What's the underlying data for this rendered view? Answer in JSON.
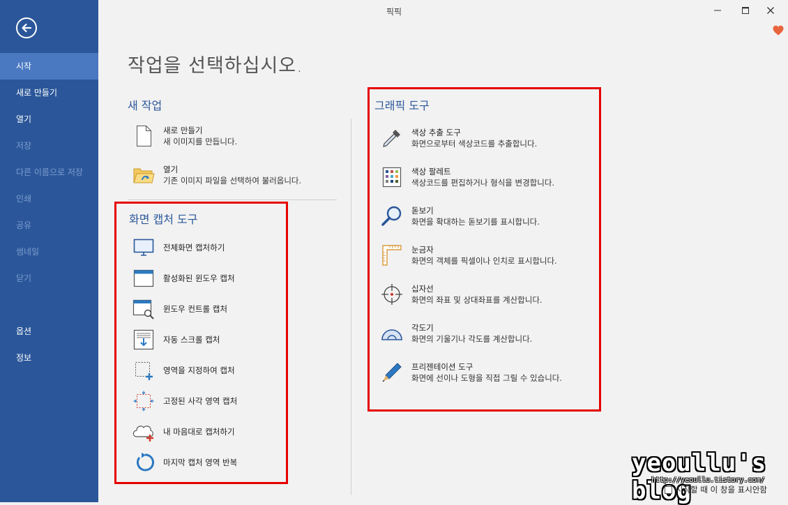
{
  "app": {
    "title": "픽픽"
  },
  "sidebar": {
    "items": [
      {
        "label": "시작",
        "state": "active"
      },
      {
        "label": "새로 만들기",
        "state": "normal"
      },
      {
        "label": "열기",
        "state": "normal"
      },
      {
        "label": "저장",
        "state": "disabled"
      },
      {
        "label": "다른 이름으로 저장",
        "state": "disabled"
      },
      {
        "label": "인쇄",
        "state": "disabled"
      },
      {
        "label": "공유",
        "state": "disabled"
      },
      {
        "label": "썸네일",
        "state": "disabled"
      },
      {
        "label": "닫기",
        "state": "disabled"
      },
      {
        "label": "옵션",
        "state": "normal"
      },
      {
        "label": "정보",
        "state": "normal"
      }
    ]
  },
  "main": {
    "title": "작업을 선택하십시오.",
    "new_task": {
      "title": "새 작업",
      "items": [
        {
          "title": "새로 만들기",
          "desc": "새 이미지를 만듭니다.",
          "icon": "new-file-icon"
        },
        {
          "title": "열기",
          "desc": "기존 이미지 파일을 선택하여 불러옵니다.",
          "icon": "open-folder-icon"
        }
      ]
    },
    "capture": {
      "title": "화면 캡처 도구",
      "items": [
        {
          "label": "전체화면 캡처하기",
          "icon": "monitor-icon"
        },
        {
          "label": "활성화된 윈도우 캡처",
          "icon": "window-icon"
        },
        {
          "label": "윈도우 컨트롤 캡처",
          "icon": "window-control-icon"
        },
        {
          "label": "자동 스크롤 캡처",
          "icon": "scroll-capture-icon"
        },
        {
          "label": "영역을 지정하여 캡처",
          "icon": "region-capture-icon"
        },
        {
          "label": "고정된 사각 영역 캡처",
          "icon": "fixed-region-icon"
        },
        {
          "label": "내 마음대로 캡처하기",
          "icon": "freehand-capture-icon"
        },
        {
          "label": "마지막 캡처 영역 반복",
          "icon": "repeat-capture-icon"
        }
      ]
    },
    "graphics": {
      "title": "그래픽 도구",
      "items": [
        {
          "title": "색상 추출 도구",
          "desc": "화면으로부터 색상코드를 추출합니다.",
          "icon": "eyedropper-icon"
        },
        {
          "title": "색상 팔레트",
          "desc": "색상코드를 편집하거나 형식을 변경합니다.",
          "icon": "palette-icon"
        },
        {
          "title": "돋보기",
          "desc": "화면을 확대하는 돋보기를 표시합니다.",
          "icon": "magnifier-icon"
        },
        {
          "title": "눈금자",
          "desc": "화면의 객체를 픽셀이나 인치로 표시합니다.",
          "icon": "ruler-icon"
        },
        {
          "title": "십자선",
          "desc": "화면의 좌표 및 상대좌표를 계산합니다.",
          "icon": "crosshair-icon"
        },
        {
          "title": "각도기",
          "desc": "화면의 기울기나 각도를 계산합니다.",
          "icon": "protractor-icon"
        },
        {
          "title": "프리젠테이션 도구",
          "desc": "화면에 선이나 도형을 직접 그릴 수 있습니다.",
          "icon": "pen-icon"
        }
      ]
    }
  },
  "watermark": {
    "blog": "yeoullu's blog",
    "url": "http://yeoullu.tistory.com/"
  },
  "footer": {
    "checkbox_label": "시작할 때 이 창을 표시안함"
  },
  "colors": {
    "sidebar": "#2b579a",
    "accent": "#2b579a",
    "highlight": "#e60000"
  }
}
